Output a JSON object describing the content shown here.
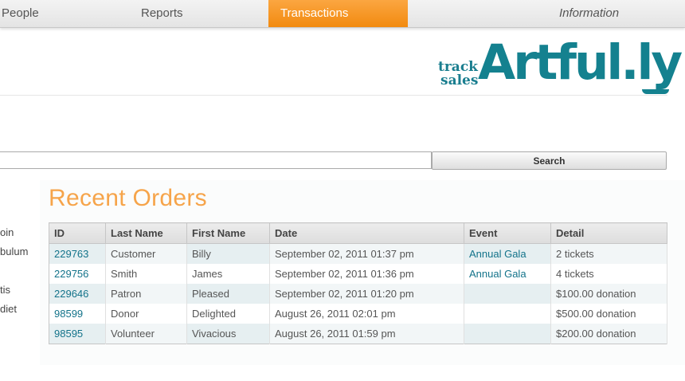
{
  "nav": {
    "items": [
      {
        "label": "People",
        "active": false
      },
      {
        "label": "Reports",
        "active": false
      },
      {
        "label": "Transactions",
        "active": true
      },
      {
        "label": "Information",
        "active": false
      }
    ],
    "active_color": "#f28a0f"
  },
  "logo": {
    "tagline_top": "track",
    "tagline_bottom": "sales",
    "wordmark": "Artful.ly",
    "brand_color": "#14818f"
  },
  "search": {
    "value": "",
    "button_label": "Search"
  },
  "sidebar": {
    "fragments": [
      "oin",
      "bulum",
      "tis",
      "diet"
    ]
  },
  "orders": {
    "title": "Recent Orders",
    "title_color": "#f6a44a",
    "columns": [
      "ID",
      "Last Name",
      "First Name",
      "Date",
      "Event",
      "Detail"
    ],
    "rows": [
      {
        "id": "229763",
        "last": "Customer",
        "first": "Billy",
        "date": "September 02, 2011 01:37 pm",
        "event": "Annual Gala",
        "detail": "2 tickets"
      },
      {
        "id": "229756",
        "last": "Smith",
        "first": "James",
        "date": "September 02, 2011 01:36 pm",
        "event": "Annual Gala",
        "detail": "4 tickets"
      },
      {
        "id": "229646",
        "last": "Patron",
        "first": "Pleased",
        "date": "September 02, 2011 01:20 pm",
        "event": "",
        "detail": "$100.00 donation"
      },
      {
        "id": "98599",
        "last": "Donor",
        "first": "Delighted",
        "date": "August 26, 2011 02:01 pm",
        "event": "",
        "detail": "$500.00 donation"
      },
      {
        "id": "98595",
        "last": "Volunteer",
        "first": "Vivacious",
        "date": "August 26, 2011 01:59 pm",
        "event": "",
        "detail": "$200.00 donation"
      }
    ]
  }
}
